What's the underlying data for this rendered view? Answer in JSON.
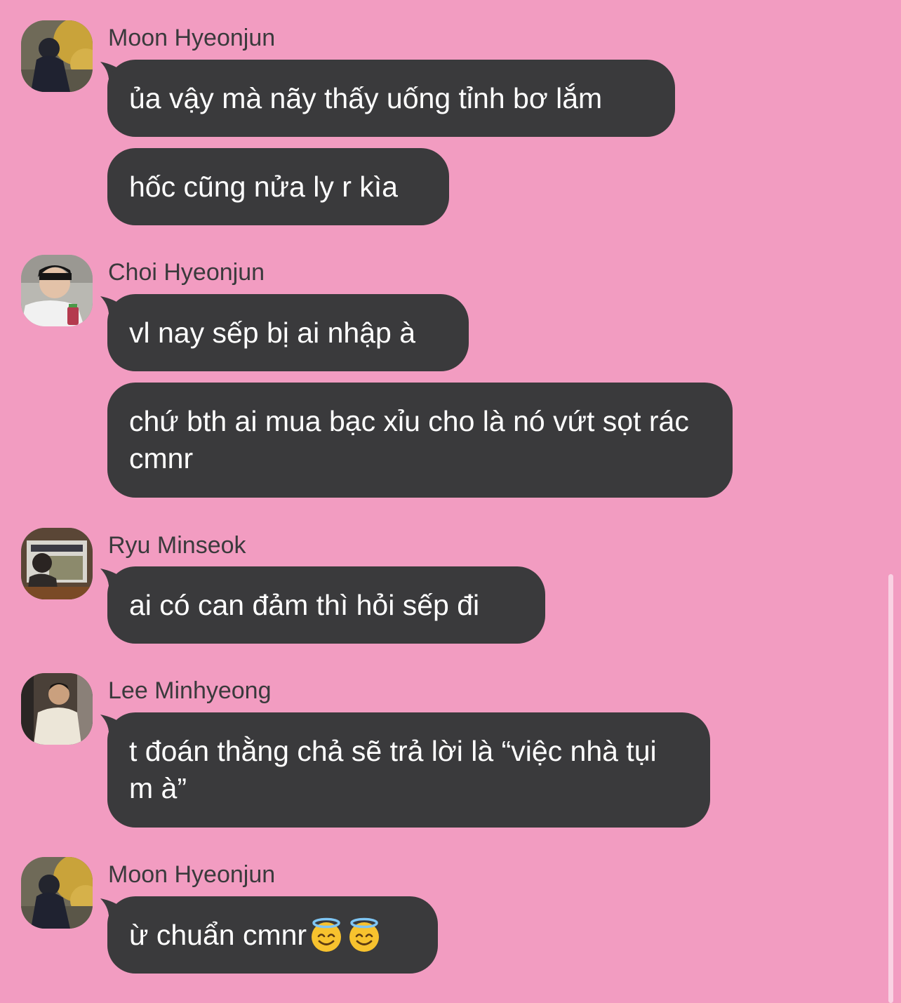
{
  "colors": {
    "background": "#f29cc1",
    "bubble": "#3a3a3c",
    "bubble_text": "#ffffff",
    "sender_text": "#3a3a3c"
  },
  "messages": [
    {
      "sender": "Moon Hyeonjun",
      "avatar": "avatar-moon-hyeonjun",
      "bubbles": [
        "ủa vậy mà nãy thấy uống tỉnh bơ lắm",
        "hốc cũng nửa ly r kìa"
      ]
    },
    {
      "sender": "Choi Hyeonjun",
      "avatar": "avatar-choi-hyeonjun",
      "bubbles": [
        "vl nay sếp bị ai nhập à",
        "chứ bth ai mua bạc xỉu cho là nó vứt sọt rác cmnr"
      ]
    },
    {
      "sender": "Ryu Minseok",
      "avatar": "avatar-ryu-minseok",
      "bubbles": [
        "ai có can đảm thì hỏi sếp đi"
      ]
    },
    {
      "sender": "Lee Minhyeong",
      "avatar": "avatar-lee-minhyeong",
      "bubbles": [
        "t đoán thằng chả sẽ trả lời là “việc nhà tụi m à”"
      ]
    },
    {
      "sender": "Moon Hyeonjun",
      "avatar": "avatar-moon-hyeonjun",
      "bubbles": [
        "ừ chuẩn cmnr"
      ],
      "emoji": [
        "smiling-face-with-halo-icon",
        "smiling-face-with-halo-icon"
      ]
    }
  ]
}
